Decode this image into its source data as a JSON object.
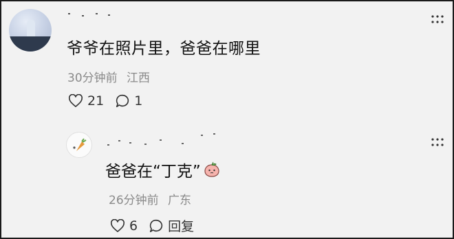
{
  "comment": {
    "text": "爷爷在照片里，爸爸在哪里",
    "time": "30分钟前",
    "location": "江西",
    "likes": "21",
    "replies": "1"
  },
  "reply": {
    "text": "爸爸在“丁克”",
    "emoji_icon": "peach-emoji-icon",
    "time": "26分钟前",
    "location": "广东",
    "likes": "6",
    "reply_label": "回复"
  },
  "colors": {
    "background": "#f2f2f2",
    "text": "#111111",
    "meta": "#8a8a8a",
    "icon": "#333333",
    "emoji_pink": "#f4a7a2"
  }
}
